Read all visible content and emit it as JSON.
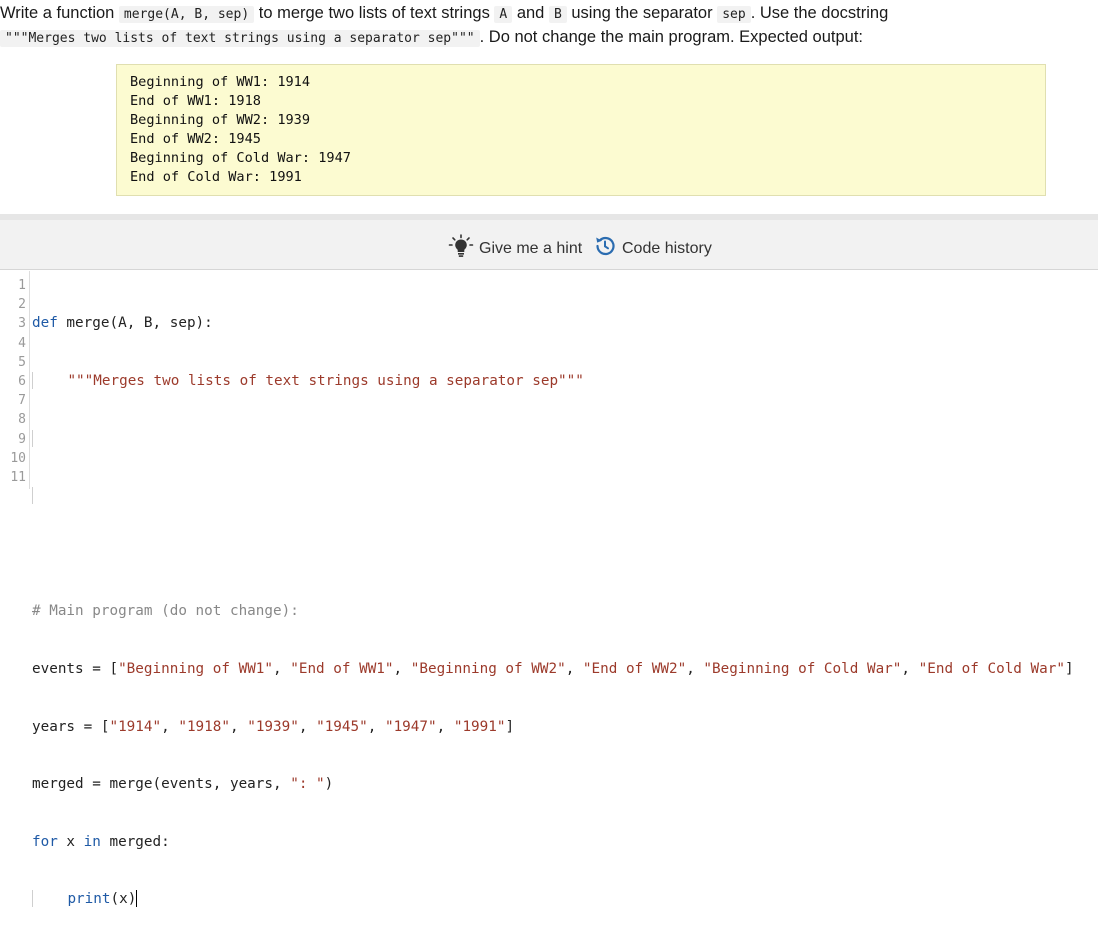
{
  "instructions": {
    "l1_t1": "Write a function ",
    "l1_c1": "merge(A, B, sep)",
    "l1_t2": " to merge two lists of text strings ",
    "l1_c2": "A",
    "l1_t3": " and ",
    "l1_c3": "B",
    "l1_t4": " using the separator ",
    "l1_c4": "sep",
    "l1_t5": ". Use the docstring",
    "l2_c1": "\"\"\"Merges two lists of text strings using a separator sep\"\"\"",
    "l2_t1": ". Do not change the main program. Expected output:"
  },
  "expected_output": [
    "Beginning of WW1: 1914",
    "End of WW1: 1918",
    "Beginning of WW2: 1939",
    "End of WW2: 1945",
    "Beginning of Cold War: 1947",
    "End of Cold War: 1991"
  ],
  "toolbar": {
    "hint_label": "Give me a hint",
    "history_label": "Code history"
  },
  "editor": {
    "line_numbers": [
      "1",
      "2",
      "3",
      "4",
      "5",
      "6",
      "7",
      "8",
      "9",
      "10",
      "11"
    ],
    "lines": {
      "l1_kw": "def",
      "l1_rest": " merge(A, B, sep):",
      "l2_doc": "\"\"\"Merges two lists of text strings using a separator sep\"\"\"",
      "l6_comment": "# Main program (do not change):",
      "l7_pre": "events = [",
      "l7_s1": "\"Beginning of WW1\"",
      "l7_s2": "\"End of WW1\"",
      "l7_s3": "\"Beginning of WW2\"",
      "l7_s4": "\"End of WW2\"",
      "l7_s5": "\"Beginning of Cold War\"",
      "l7_s6": "\"End of Cold War\"",
      "l7_post": "]",
      "l8_pre": "years = [",
      "l8_s1": "\"1914\"",
      "l8_s2": "\"1918\"",
      "l8_s3": "\"1939\"",
      "l8_s4": "\"1945\"",
      "l8_s5": "\"1947\"",
      "l8_s6": "\"1991\"",
      "l8_post": "]",
      "l9_pre": "merged = merge(events, years, ",
      "l9_str": "\": \"",
      "l9_post": ")",
      "l10_kw1": "for",
      "l10_mid": " x ",
      "l10_kw2": "in",
      "l10_rest": " merged:",
      "l11_fn": "print",
      "l11_rest": "(x)",
      "sep": ", "
    }
  },
  "colors": {
    "keyword": "#1f5aa6",
    "string": "#9c3a2b",
    "comment": "#888888",
    "expected_bg": "#fcfbd1",
    "toolbar_bg": "#f2f2f2"
  }
}
